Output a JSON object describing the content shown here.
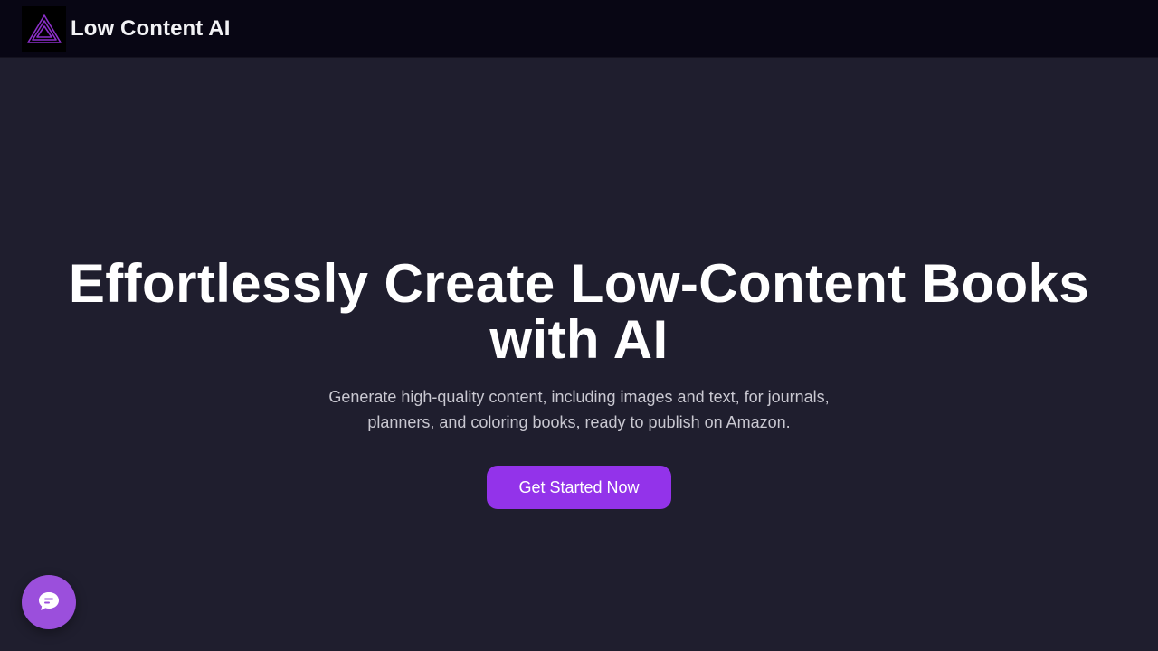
{
  "header": {
    "brand_name": "Low Content AI",
    "logo_icon": "triangle-logo-icon"
  },
  "hero": {
    "title": "Effortlessly Create Low-Content Books with AI",
    "subtitle": "Generate high-quality content, including images and text, for journals, planners, and coloring books, ready to publish on Amazon.",
    "cta_label": "Get Started Now"
  },
  "chat_widget": {
    "icon": "chat-bubble-icon"
  },
  "colors": {
    "page_bg": "#1f1e2e",
    "header_bg": "#080614",
    "accent": "#9333ea",
    "chat_bg": "#9b4fdc",
    "logo_stroke": "#8b2fc9"
  }
}
